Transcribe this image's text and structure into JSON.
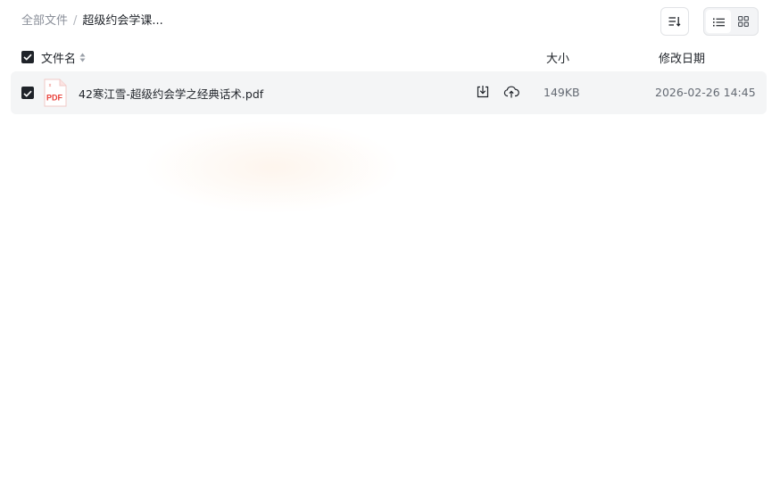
{
  "breadcrumb": {
    "root": "全部文件",
    "separator": "/",
    "current": "超级约会学课..."
  },
  "toolbar": {
    "sort_icon": "sort-list-icon",
    "view_list_icon": "list-view-icon",
    "view_grid_icon": "grid-view-icon",
    "active_view": "list"
  },
  "table": {
    "header": {
      "name": "文件名",
      "size": "大小",
      "date": "修改日期",
      "all_selected": true
    },
    "rows": [
      {
        "name": "42寒江雪-超级约会学之经典话术.pdf",
        "type_badge": "PDF",
        "size": "149KB",
        "modified": "2026-02-26 14:45",
        "selected": true,
        "actions": [
          "download-icon",
          "cloud-save-icon"
        ]
      }
    ]
  },
  "colors": {
    "text_primary": "#1f2329",
    "text_secondary": "#646a73",
    "text_muted": "#8a8f99",
    "row_bg": "#f4f5f6",
    "pdf_red": "#e8413a",
    "checkbox": "#1f2329"
  }
}
